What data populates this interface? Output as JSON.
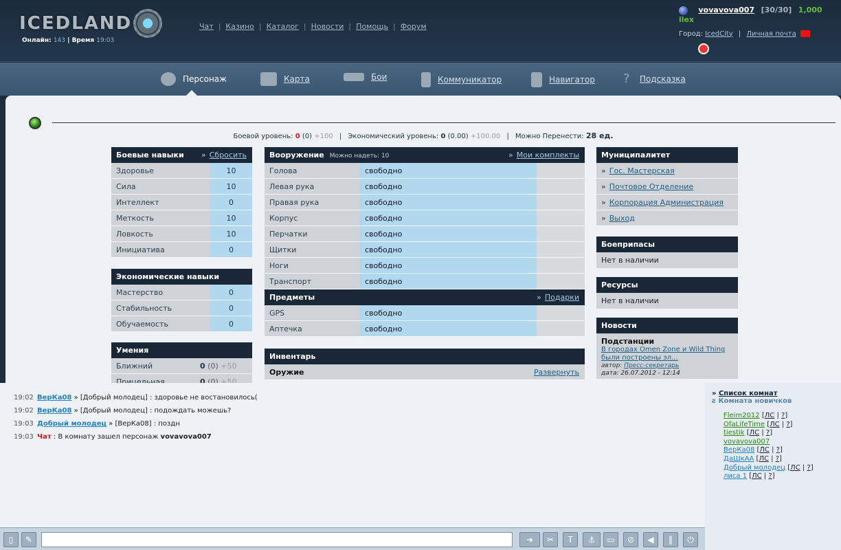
{
  "header": {
    "logo_text": "ICEDLAND",
    "online_label": "Онлайн:",
    "online_count": "143",
    "time_label": "Время",
    "time_value": "19:03",
    "menu": [
      "Чат",
      "Казино",
      "Каталог",
      "Новости",
      "Помощь",
      "Форум"
    ],
    "user": {
      "name": "vovavova007",
      "hp": "[30/30]",
      "money": "1,000 ilex",
      "city_label": "Город:",
      "city": "IcedCity",
      "mail_label": "Личная почта"
    }
  },
  "nav": {
    "items": [
      {
        "label": "Персонаж",
        "icon": "character-icon"
      },
      {
        "label": "Карта",
        "icon": "map-icon"
      },
      {
        "label": "Бои",
        "icon": "gun-icon"
      },
      {
        "label": "Коммуникатор",
        "icon": "phone-icon"
      },
      {
        "label": "Навигатор",
        "icon": "navigator-icon"
      },
      {
        "label": "Подсказка",
        "icon": "question-icon"
      }
    ]
  },
  "levels": {
    "combat_label": "Боевой уровень:",
    "combat_value": "0",
    "combat_paren": "(0)",
    "combat_next": "+100",
    "econ_label": "Экономический уровень:",
    "econ_value": "0",
    "econ_paren": "(0.00)",
    "econ_next": "+100.00",
    "carry_label": "Можно Перенести:",
    "carry_value": "28 ед."
  },
  "combat_skills": {
    "title": "Боевые навыки",
    "reset": "Сбросить",
    "rows": [
      {
        "name": "Здоровье",
        "value": "10"
      },
      {
        "name": "Сила",
        "value": "10"
      },
      {
        "name": "Интеллект",
        "value": "0"
      },
      {
        "name": "Меткость",
        "value": "10"
      },
      {
        "name": "Ловкость",
        "value": "10"
      },
      {
        "name": "Инициатива",
        "value": "0"
      }
    ]
  },
  "econ_skills": {
    "title": "Экономические навыки",
    "rows": [
      {
        "name": "Мастерство",
        "value": "0"
      },
      {
        "name": "Стабильность",
        "value": "0"
      },
      {
        "name": "Обучаемость",
        "value": "0"
      }
    ]
  },
  "abilities": {
    "title": "Умения",
    "rows": [
      {
        "name": "Ближний",
        "value": "0",
        "paren": "(0)",
        "next": "+50"
      },
      {
        "name": "Прицельная",
        "value": "0",
        "paren": "(0)",
        "next": "+50"
      }
    ]
  },
  "armament": {
    "title": "Вооружение",
    "sub": "Можно надеть: 10",
    "sets": "Мои комплекты",
    "rows": [
      {
        "slot": "Голова",
        "value": "свободно"
      },
      {
        "slot": "Левая рука",
        "value": "свободно"
      },
      {
        "slot": "Правая рука",
        "value": "свободно"
      },
      {
        "slot": "Корпус",
        "value": "свободно"
      },
      {
        "slot": "Перчатки",
        "value": "свободно"
      },
      {
        "slot": "Щитки",
        "value": "свободно"
      },
      {
        "slot": "Ноги",
        "value": "свободно"
      },
      {
        "slot": "Транспорт",
        "value": "свободно"
      }
    ]
  },
  "items": {
    "title": "Предметы",
    "gifts": "Подарки",
    "rows": [
      {
        "slot": "GPS",
        "value": "свободно"
      },
      {
        "slot": "Аптечка",
        "value": "свободно"
      }
    ]
  },
  "inventory": {
    "title": "Инвентарь",
    "weapon_label": "Оружие",
    "expand": "Развернуть"
  },
  "municipality": {
    "title": "Муниципалитет",
    "links": [
      "Гос. Мастерская",
      "Почтовое Отделение",
      "Корпорация Администрация",
      "Выход"
    ]
  },
  "ammo": {
    "title": "Боеприпасы",
    "text": "Нет в наличии"
  },
  "resources": {
    "title": "Ресурсы",
    "text": "Нет в наличии"
  },
  "news": {
    "title": "Новости",
    "item_title": "Подстанции",
    "item_text": "В городах Omen Zone и Wild Thing были построены эл...",
    "author_label": "автор:",
    "author": "Пресс-секретарь",
    "date_label": "дата:",
    "date": "26.07.2012 - 12:14"
  },
  "chat": {
    "messages": [
      {
        "time": "19:02",
        "nick": "ВерКа08",
        "text": "» [Добрый молодец] : здоровье не востановилось("
      },
      {
        "time": "19:02",
        "nick": "ВерКа08",
        "text": "» [Добрый молодец] : подождать можешь?"
      },
      {
        "time": "19:03",
        "nick": "Добрый молодец",
        "text": "» [ВерКа08] : поздн"
      },
      {
        "time": "19:03",
        "sys": "Чат",
        "text": ": В комнату зашел персонаж",
        "who": "vovavova007"
      }
    ],
    "input_value": ""
  },
  "rooms": {
    "list_label": "Список комнат",
    "room_name": "Комната новичков",
    "users": [
      {
        "name": "Fleim2012",
        "color": "green"
      },
      {
        "name": "OfaLifeTime",
        "color": "green"
      },
      {
        "name": "tiestik",
        "color": "green"
      },
      {
        "name": "vovavova007",
        "color": "green"
      },
      {
        "name": "ВерКа08",
        "color": "blue"
      },
      {
        "name": "ДаШкАА",
        "color": "blue"
      },
      {
        "name": "Добрый молодец",
        "color": "blue"
      },
      {
        "name": "лиса 1",
        "color": "blue"
      }
    ],
    "pm": "ЛС",
    "q": "?"
  },
  "colors": {
    "accent": "#1a2736",
    "value_cell": "#b2d8f0",
    "label_cell": "#cfd3d7"
  }
}
